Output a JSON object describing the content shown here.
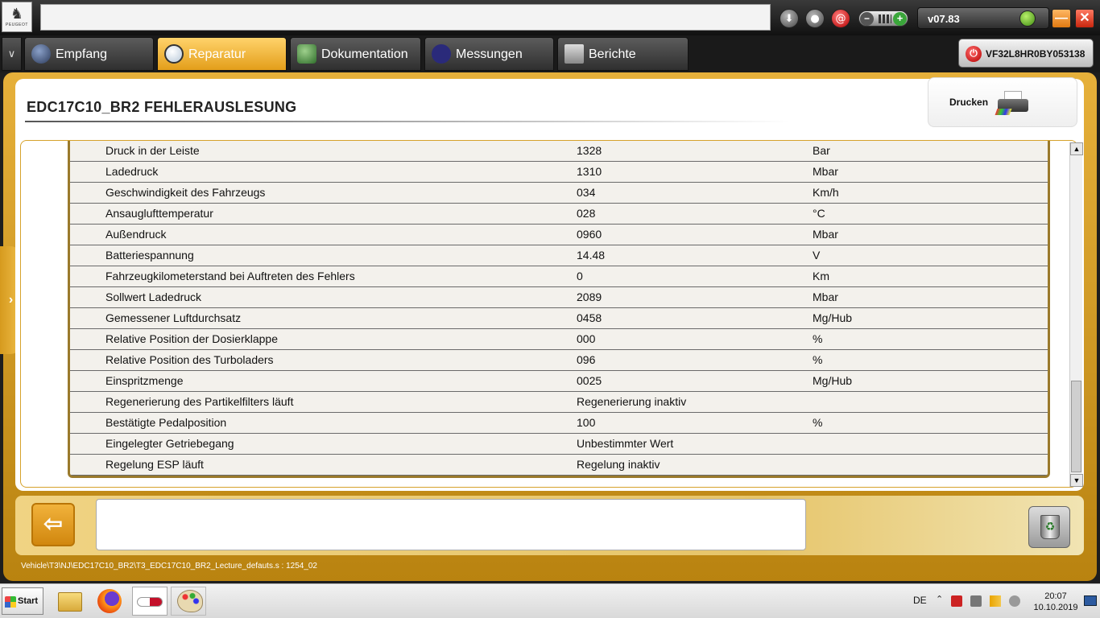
{
  "brand": {
    "name": "PEUGEOT"
  },
  "topbar": {
    "icons": [
      "download-icon",
      "user-icon",
      "mail-icon",
      "volume-toggle",
      "connection-icon"
    ],
    "version": "v07.83"
  },
  "tabs": [
    {
      "label": "Empfang",
      "icon": "globe-icon",
      "active": false
    },
    {
      "label": "Reparatur",
      "icon": "magnifier-icon",
      "active": true
    },
    {
      "label": "Dokumentation",
      "icon": "book-icon",
      "active": false
    },
    {
      "label": "Messungen",
      "icon": "waveform-icon",
      "active": false
    },
    {
      "label": "Berichte",
      "icon": "report-icon",
      "active": false
    }
  ],
  "vin": "VF32L8HR0BY053138",
  "page": {
    "title": "EDC17C10_BR2  FEHLERAUSLESUNG",
    "print_label": "Drucken"
  },
  "rows": [
    {
      "name": "Druck in der Leiste",
      "value": "1328",
      "unit": "Bar"
    },
    {
      "name": "Ladedruck",
      "value": "1310",
      "unit": "Mbar"
    },
    {
      "name": "Geschwindigkeit des Fahrzeugs",
      "value": "034",
      "unit": "Km/h"
    },
    {
      "name": "Ansauglufttemperatur",
      "value": "028",
      "unit": "°C"
    },
    {
      "name": "Außendruck",
      "value": "0960",
      "unit": "Mbar"
    },
    {
      "name": "Batteriespannung",
      "value": "14.48",
      "unit": "V"
    },
    {
      "name": "Fahrzeugkilometerstand bei Auftreten des Fehlers",
      "value": "0",
      "unit": "Km"
    },
    {
      "name": "Sollwert Ladedruck",
      "value": "2089",
      "unit": "Mbar"
    },
    {
      "name": "Gemessener Luftdurchsatz",
      "value": "0458",
      "unit": "Mg/Hub"
    },
    {
      "name": "Relative Position der Dosierklappe",
      "value": "000",
      "unit": "%"
    },
    {
      "name": "Relative Position des Turboladers",
      "value": "096",
      "unit": "%"
    },
    {
      "name": "Einspritzmenge",
      "value": "0025",
      "unit": "Mg/Hub"
    },
    {
      "name": "Regenerierung des Partikelfilters läuft",
      "value": "Regenerierung inaktiv",
      "unit": ""
    },
    {
      "name": "Bestätigte Pedalposition",
      "value": "100",
      "unit": "%"
    },
    {
      "name": "Eingelegter Getriebegang",
      "value": "Unbestimmter Wert",
      "unit": ""
    },
    {
      "name": "Regelung ESP läuft",
      "value": "Regelung inaktiv",
      "unit": ""
    }
  ],
  "footer": {
    "path": "Vehicle\\T3\\NJ\\EDC17C10_BR2\\T3_EDC17C10_BR2_Lecture_defauts.s : 1254_02"
  },
  "taskbar": {
    "start_label": "Start",
    "language": "DE",
    "time": "20:07",
    "date": "10.10.2019"
  },
  "colors": {
    "accent": "#e39e1a",
    "frame": "#d29a22",
    "table_bg": "#f3f1ec"
  }
}
